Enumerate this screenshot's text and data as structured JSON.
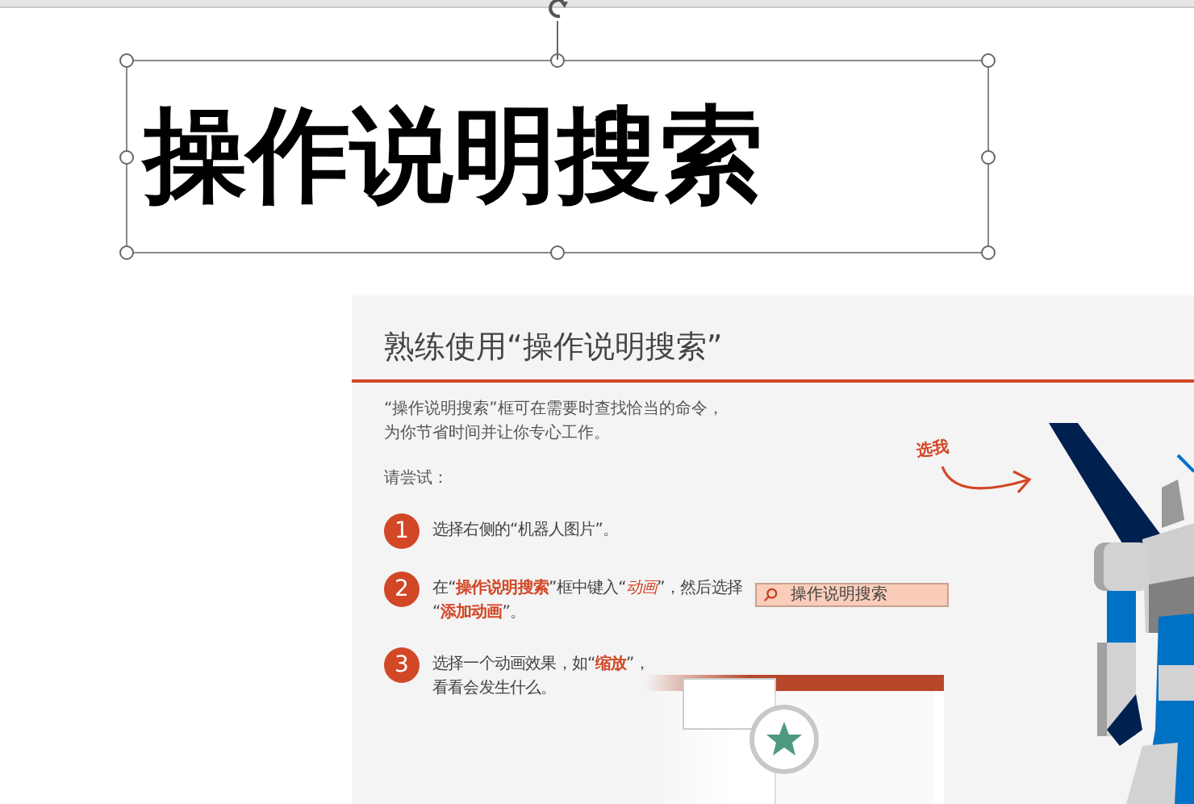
{
  "text_box": {
    "text": "操作说明搜索",
    "selected": true
  },
  "slide": {
    "title": "熟练使用“操作说明搜索”",
    "intro": [
      "“操作说明搜索”框可在需要时查找恰当的命令，",
      "为你节省时间并让你专心工作。"
    ],
    "prompt": "请尝试：",
    "callout": "选我",
    "steps": [
      {
        "number": "1",
        "lines": [
          "选择右侧的“机器人图片”。"
        ]
      },
      {
        "number": "2",
        "lines": [
          "在“**操作说明搜索**”框中键入“*动画*”，然后选择",
          "“**添加动画**”。"
        ]
      },
      {
        "number": "3",
        "lines": [
          "选择一个动画效果，如“**缩放**”，",
          "看看会发生什么。"
        ]
      }
    ],
    "search_box": {
      "placeholder": "操作说明搜索"
    }
  }
}
